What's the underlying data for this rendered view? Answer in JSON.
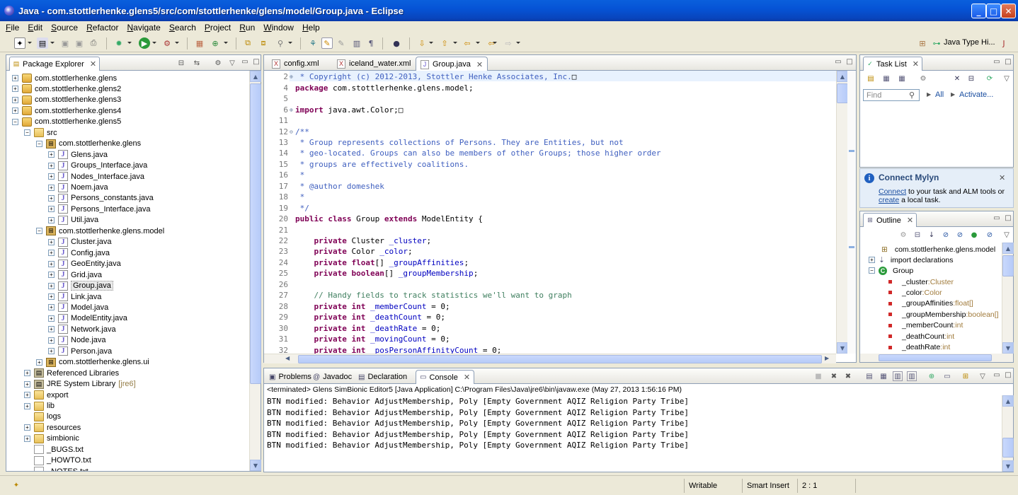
{
  "window": {
    "title": "Java - com.stottlerhenke.glens5/src/com/stottlerhenke/glens/model/Group.java - Eclipse",
    "min_label": "_",
    "max_label": "□",
    "close_label": "✕"
  },
  "menu": [
    "File",
    "Edit",
    "Source",
    "Refactor",
    "Navigate",
    "Search",
    "Project",
    "Run",
    "Window",
    "Help"
  ],
  "toolbar": {
    "perspective_label": "Java Type Hi..."
  },
  "package_explorer": {
    "title": "Package Explorer",
    "items": [
      {
        "label": "com.stottlerhenke.glens",
        "type": "proj",
        "exp": "+",
        "indent": 0
      },
      {
        "label": "com.stottlerhenke.glens2",
        "type": "proj",
        "exp": "+",
        "indent": 0
      },
      {
        "label": "com.stottlerhenke.glens3",
        "type": "proj",
        "exp": "+",
        "indent": 0
      },
      {
        "label": "com.stottlerhenke.glens4",
        "type": "proj",
        "exp": "+",
        "indent": 0
      },
      {
        "label": "com.stottlerhenke.glens5",
        "type": "proj",
        "exp": "−",
        "indent": 0
      },
      {
        "label": "src",
        "type": "folder",
        "exp": "−",
        "indent": 1
      },
      {
        "label": "com.stottlerhenke.glens",
        "type": "pkg",
        "exp": "−",
        "indent": 2
      },
      {
        "label": "Glens.java",
        "type": "java",
        "exp": "+",
        "indent": 3
      },
      {
        "label": "Groups_Interface.java",
        "type": "java",
        "exp": "+",
        "indent": 3
      },
      {
        "label": "Nodes_Interface.java",
        "type": "java",
        "exp": "+",
        "indent": 3
      },
      {
        "label": "Noem.java",
        "type": "java",
        "exp": "+",
        "indent": 3
      },
      {
        "label": "Persons_constants.java",
        "type": "java",
        "exp": "+",
        "indent": 3
      },
      {
        "label": "Persons_Interface.java",
        "type": "java",
        "exp": "+",
        "indent": 3
      },
      {
        "label": "Util.java",
        "type": "java",
        "exp": "+",
        "indent": 3
      },
      {
        "label": "com.stottlerhenke.glens.model",
        "type": "pkg",
        "exp": "−",
        "indent": 2
      },
      {
        "label": "Cluster.java",
        "type": "java",
        "exp": "+",
        "indent": 3
      },
      {
        "label": "Config.java",
        "type": "java",
        "exp": "+",
        "indent": 3
      },
      {
        "label": "GeoEntity.java",
        "type": "java",
        "exp": "+",
        "indent": 3
      },
      {
        "label": "Grid.java",
        "type": "java",
        "exp": "+",
        "indent": 3
      },
      {
        "label": "Group.java",
        "type": "java",
        "exp": "+",
        "indent": 3,
        "selected": true
      },
      {
        "label": "Link.java",
        "type": "java",
        "exp": "+",
        "indent": 3
      },
      {
        "label": "Model.java",
        "type": "java",
        "exp": "+",
        "indent": 3
      },
      {
        "label": "ModelEntity.java",
        "type": "java",
        "exp": "+",
        "indent": 3
      },
      {
        "label": "Network.java",
        "type": "java",
        "exp": "+",
        "indent": 3
      },
      {
        "label": "Node.java",
        "type": "java",
        "exp": "+",
        "indent": 3
      },
      {
        "label": "Person.java",
        "type": "java",
        "exp": "+",
        "indent": 3
      },
      {
        "label": "com.stottlerhenke.glens.ui",
        "type": "pkg",
        "exp": "+",
        "indent": 2
      },
      {
        "label": "Referenced Libraries",
        "type": "lib",
        "exp": "+",
        "indent": 1
      },
      {
        "label": "JRE System Library",
        "suffix": "[jre6]",
        "type": "lib",
        "exp": "+",
        "indent": 1
      },
      {
        "label": "export",
        "type": "folder",
        "exp": "+",
        "indent": 1
      },
      {
        "label": "lib",
        "type": "folder",
        "exp": "+",
        "indent": 1
      },
      {
        "label": "logs",
        "type": "folder",
        "exp": "",
        "indent": 1
      },
      {
        "label": "resources",
        "type": "folder",
        "exp": "+",
        "indent": 1
      },
      {
        "label": "simbionic",
        "type": "folder",
        "exp": "+",
        "indent": 1
      },
      {
        "label": "_BUGS.txt",
        "type": "txt",
        "exp": "",
        "indent": 1
      },
      {
        "label": "_HOWTO.txt",
        "type": "txt",
        "exp": "",
        "indent": 1
      },
      {
        "label": "_NOTES.txt",
        "type": "txt",
        "exp": "",
        "indent": 1
      }
    ]
  },
  "editor": {
    "tabs": [
      {
        "label": "config.xml",
        "active": false
      },
      {
        "label": "iceland_water.xml",
        "active": false
      },
      {
        "label": "Group.java",
        "active": true
      }
    ],
    "lines": [
      {
        "n": "2",
        "fold": "⊕",
        "parts": [
          {
            "c": "jd",
            "t": " * Copyright (c) 2012-2013, Stottler Henke Associates, Inc."
          },
          {
            "c": "ctext",
            "t": "□"
          }
        ]
      },
      {
        "n": "4",
        "fold": "",
        "parts": [
          {
            "c": "kw",
            "t": "package"
          },
          {
            "c": "ctext",
            "t": " com.stottlerhenke.glens.model;"
          }
        ]
      },
      {
        "n": "5",
        "fold": "",
        "parts": []
      },
      {
        "n": "6",
        "fold": "⊕",
        "parts": [
          {
            "c": "kw",
            "t": "import"
          },
          {
            "c": "ctext",
            "t": " java.awt.Color;□"
          }
        ]
      },
      {
        "n": "11",
        "fold": "",
        "parts": []
      },
      {
        "n": "12",
        "fold": "⊖",
        "parts": [
          {
            "c": "jd",
            "t": "/**"
          }
        ]
      },
      {
        "n": "13",
        "fold": "",
        "parts": [
          {
            "c": "jd",
            "t": " * Group represents collections of Persons. They are Entities, but not"
          }
        ]
      },
      {
        "n": "14",
        "fold": "",
        "parts": [
          {
            "c": "jd",
            "t": " * geo-located. Groups can also be members of other Groups; those higher order"
          }
        ]
      },
      {
        "n": "15",
        "fold": "",
        "parts": [
          {
            "c": "jd",
            "t": " * groups are effectively coalitions."
          }
        ]
      },
      {
        "n": "16",
        "fold": "",
        "parts": [
          {
            "c": "jd",
            "t": " *"
          }
        ]
      },
      {
        "n": "17",
        "fold": "",
        "parts": [
          {
            "c": "jd",
            "t": " * @author domeshek"
          }
        ]
      },
      {
        "n": "18",
        "fold": "",
        "parts": [
          {
            "c": "jd",
            "t": " *"
          }
        ]
      },
      {
        "n": "19",
        "fold": "",
        "parts": [
          {
            "c": "jd",
            "t": " */"
          }
        ]
      },
      {
        "n": "20",
        "fold": "",
        "parts": [
          {
            "c": "kw",
            "t": "public class"
          },
          {
            "c": "ctext",
            "t": " Group "
          },
          {
            "c": "kw",
            "t": "extends"
          },
          {
            "c": "ctext",
            "t": " ModelEntity {"
          }
        ]
      },
      {
        "n": "21",
        "fold": "",
        "parts": []
      },
      {
        "n": "22",
        "fold": "",
        "parts": [
          {
            "c": "ctext",
            "t": "    "
          },
          {
            "c": "kw",
            "t": "private"
          },
          {
            "c": "ctext",
            "t": " Cluster "
          },
          {
            "c": "fld",
            "t": "_cluster"
          },
          {
            "c": "ctext",
            "t": ";"
          }
        ]
      },
      {
        "n": "23",
        "fold": "",
        "parts": [
          {
            "c": "ctext",
            "t": "    "
          },
          {
            "c": "kw",
            "t": "private"
          },
          {
            "c": "ctext",
            "t": " Color "
          },
          {
            "c": "fld",
            "t": "_color"
          },
          {
            "c": "ctext",
            "t": ";"
          }
        ]
      },
      {
        "n": "24",
        "fold": "",
        "parts": [
          {
            "c": "ctext",
            "t": "    "
          },
          {
            "c": "kw",
            "t": "private float"
          },
          {
            "c": "ctext",
            "t": "[] "
          },
          {
            "c": "fld",
            "t": "_groupAffinities"
          },
          {
            "c": "ctext",
            "t": ";"
          }
        ]
      },
      {
        "n": "25",
        "fold": "",
        "parts": [
          {
            "c": "ctext",
            "t": "    "
          },
          {
            "c": "kw",
            "t": "private boolean"
          },
          {
            "c": "ctext",
            "t": "[] "
          },
          {
            "c": "fld",
            "t": "_groupMembership"
          },
          {
            "c": "ctext",
            "t": ";"
          }
        ]
      },
      {
        "n": "26",
        "fold": "",
        "parts": []
      },
      {
        "n": "27",
        "fold": "",
        "parts": [
          {
            "c": "ctext",
            "t": "    "
          },
          {
            "c": "cm",
            "t": "// Handy fields to track statistics we'll want to graph"
          }
        ]
      },
      {
        "n": "28",
        "fold": "",
        "parts": [
          {
            "c": "ctext",
            "t": "    "
          },
          {
            "c": "kw",
            "t": "private int"
          },
          {
            "c": "ctext",
            "t": " "
          },
          {
            "c": "fld",
            "t": "_memberCount"
          },
          {
            "c": "ctext",
            "t": " = 0;"
          }
        ]
      },
      {
        "n": "29",
        "fold": "",
        "parts": [
          {
            "c": "ctext",
            "t": "    "
          },
          {
            "c": "kw",
            "t": "private int"
          },
          {
            "c": "ctext",
            "t": " "
          },
          {
            "c": "fld",
            "t": "_deathCount"
          },
          {
            "c": "ctext",
            "t": " = 0;"
          }
        ]
      },
      {
        "n": "30",
        "fold": "",
        "parts": [
          {
            "c": "ctext",
            "t": "    "
          },
          {
            "c": "kw",
            "t": "private int"
          },
          {
            "c": "ctext",
            "t": " "
          },
          {
            "c": "fld",
            "t": "_deathRate"
          },
          {
            "c": "ctext",
            "t": " = 0;"
          }
        ]
      },
      {
        "n": "31",
        "fold": "",
        "parts": [
          {
            "c": "ctext",
            "t": "    "
          },
          {
            "c": "kw",
            "t": "private int"
          },
          {
            "c": "ctext",
            "t": " "
          },
          {
            "c": "fld",
            "t": "_movingCount"
          },
          {
            "c": "ctext",
            "t": " = 0;"
          }
        ]
      },
      {
        "n": "32",
        "fold": "",
        "parts": [
          {
            "c": "ctext",
            "t": "    "
          },
          {
            "c": "kw",
            "t": "private int"
          },
          {
            "c": "ctext",
            "t": " "
          },
          {
            "c": "fld",
            "t": "_posPersonAffinityCount"
          },
          {
            "c": "ctext",
            "t": " = 0;"
          }
        ]
      }
    ]
  },
  "task_list": {
    "title": "Task List",
    "find_placeholder": "Find",
    "all_label": "All",
    "activate_label": "Activate..."
  },
  "mylyn": {
    "title": "Connect Mylyn",
    "connect_link": "Connect",
    "text1": " to your task and ALM tools or",
    "create_link": "create",
    "text2": " a local task."
  },
  "outline": {
    "title": "Outline",
    "package": "com.stottlerhenke.glens.model",
    "imports": "import declarations",
    "class_name": "Group",
    "fields": [
      {
        "name": "_cluster",
        "type": "Cluster"
      },
      {
        "name": "_color",
        "type": "Color"
      },
      {
        "name": "_groupAffinities",
        "type": "float[]"
      },
      {
        "name": "_groupMembership",
        "type": "boolean[]"
      },
      {
        "name": "_memberCount",
        "type": "int"
      },
      {
        "name": "_deathCount",
        "type": "int"
      },
      {
        "name": "_deathRate",
        "type": "int"
      }
    ]
  },
  "bottom_panel": {
    "tabs": [
      {
        "label": "Problems",
        "icon": "problems-icon",
        "active": false
      },
      {
        "label": "Javadoc",
        "icon": "javadoc-icon",
        "active": false
      },
      {
        "label": "Declaration",
        "icon": "declaration-icon",
        "active": false
      },
      {
        "label": "Console",
        "icon": "console-icon",
        "active": true
      }
    ],
    "console_header": "<terminated> Glens SimBionic Editor5 [Java Application] C:\\Program Files\\Java\\jre6\\bin\\javaw.exe (May 27, 2013 1:56:16 PM)",
    "lines": [
      "BTN modified: Behavior AdjustMembership, Poly [Empty Government AQIZ Religion Party Tribe]",
      "BTN modified: Behavior AdjustMembership, Poly [Empty Government AQIZ Religion Party Tribe]",
      "BTN modified: Behavior AdjustMembership, Poly [Empty Government AQIZ Religion Party Tribe]",
      "BTN modified: Behavior AdjustMembership, Poly [Empty Government AQIZ Religion Party Tribe]",
      "BTN modified: Behavior AdjustMembership, Poly [Empty Government AQIZ Religion Party Tribe]"
    ]
  },
  "status": {
    "writable": "Writable",
    "insert_mode": "Smart Insert",
    "position": "2 : 1"
  },
  "colors": {
    "keyword": "#7f0055",
    "javadoc": "#3f5fbf",
    "comment": "#3f7f5f",
    "field": "#0000c0",
    "titlebar": "#0654d6"
  }
}
